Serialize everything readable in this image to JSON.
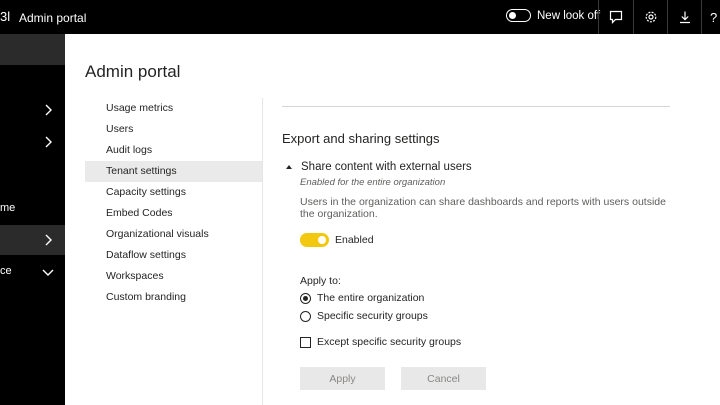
{
  "topbar": {
    "brand_glyph": "3l",
    "title": "Admin portal",
    "new_look_label": "New look off",
    "icons": [
      "chat-icon",
      "gear-icon",
      "download-icon",
      "help-icon"
    ],
    "help_glyph": "?"
  },
  "leftnav": {
    "items": [
      {
        "label": "",
        "chevron": "right"
      },
      {
        "label": "",
        "chevron": "right"
      },
      {
        "label": "me",
        "chevron": ""
      },
      {
        "label": "",
        "chevron": "right"
      },
      {
        "label": "ce",
        "chevron": "down"
      }
    ]
  },
  "page": {
    "title": "Admin portal"
  },
  "menu": {
    "items": [
      "Usage metrics",
      "Users",
      "Audit logs",
      "Tenant settings",
      "Capacity settings",
      "Embed Codes",
      "Organizational visuals",
      "Dataflow settings",
      "Workspaces",
      "Custom branding"
    ],
    "active_index": 3
  },
  "content": {
    "section_title": "Export and sharing settings",
    "setting": {
      "name": "Share content with external users",
      "subtitle": "Enabled for the entire organization",
      "description": "Users in the organization can share dashboards and reports with users outside the organization.",
      "enabled_label": "Enabled"
    },
    "apply_to": {
      "label": "Apply to:",
      "entire_org": "The entire organization",
      "specific_groups": "Specific security groups",
      "except_groups": "Except specific security groups",
      "selected": "entire_org"
    },
    "buttons": {
      "apply": "Apply",
      "cancel": "Cancel"
    }
  },
  "colors": {
    "topbar_bg": "#000000",
    "toggle_on": "#f2c811",
    "active_menu_bg": "#eaeaea"
  }
}
